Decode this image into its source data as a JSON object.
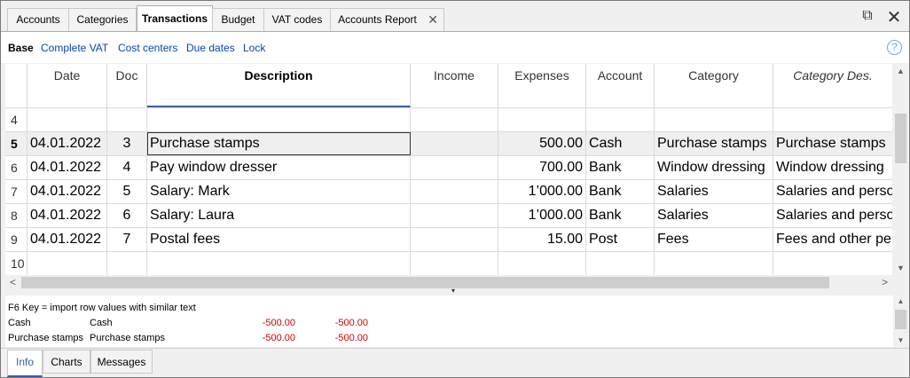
{
  "tabs": [
    {
      "label": "Accounts"
    },
    {
      "label": "Categories"
    },
    {
      "label": "Transactions"
    },
    {
      "label": "Budget"
    },
    {
      "label": "VAT codes"
    },
    {
      "label": "Accounts Report"
    }
  ],
  "active_tab": "Transactions",
  "window_controls": {
    "restore_icon": "restore-icon",
    "close_icon": "close-icon",
    "restore_glyph": "⧉",
    "close_glyph": "✕"
  },
  "views": {
    "items": [
      {
        "label": "Base"
      },
      {
        "label": "Complete VAT"
      },
      {
        "label": "Cost centers"
      },
      {
        "label": "Due dates"
      },
      {
        "label": "Lock"
      }
    ],
    "help_glyph": "?"
  },
  "table": {
    "columns": [
      "Date",
      "Doc",
      "Description",
      "Income",
      "Expenses",
      "Account",
      "Category",
      "Category Des."
    ],
    "rows": [
      {
        "num": "4",
        "date": "",
        "doc": "",
        "description": "",
        "income": "",
        "expenses": "",
        "account": "",
        "category": "",
        "category_desc": ""
      },
      {
        "num": "5",
        "date": "04.01.2022",
        "doc": "3",
        "description": "Purchase stamps",
        "income": "",
        "expenses": "500.00",
        "account": "Cash",
        "category": "Purchase stamps",
        "category_desc": "Purchase stamps"
      },
      {
        "num": "6",
        "date": "04.01.2022",
        "doc": "4",
        "description": "Pay window dresser",
        "income": "",
        "expenses": "700.00",
        "account": "Bank",
        "category": "Window dressing",
        "category_desc": "Window dressing"
      },
      {
        "num": "7",
        "date": "04.01.2022",
        "doc": "5",
        "description": "Salary: Mark",
        "income": "",
        "expenses": "1’000.00",
        "account": "Bank",
        "category": "Salaries",
        "category_desc": "Salaries and perso"
      },
      {
        "num": "8",
        "date": "04.01.2022",
        "doc": "6",
        "description": "Salary: Laura",
        "income": "",
        "expenses": "1’000.00",
        "account": "Bank",
        "category": "Salaries",
        "category_desc": "Salaries and perso"
      },
      {
        "num": "9",
        "date": "04.01.2022",
        "doc": "7",
        "description": "Postal fees",
        "income": "",
        "expenses": "15.00",
        "account": "Post",
        "category": "Fees",
        "category_desc": "Fees and other per"
      },
      {
        "num": "10",
        "date": "",
        "doc": "",
        "description": "",
        "income": "",
        "expenses": "",
        "account": "",
        "category": "",
        "category_desc": ""
      }
    ],
    "selected_row": "5"
  },
  "scroll_glyphs": {
    "up": "▲",
    "down": "▼",
    "left": "<",
    "right": ">",
    "splitter": "▾"
  },
  "info": {
    "hint": "F6 Key = import row values with similar text",
    "lines": [
      {
        "col1": "Cash",
        "col2": "Cash",
        "amount1": "-500.00",
        "amount2": "-500.00"
      },
      {
        "col1": "Purchase stamps",
        "col2": "Purchase stamps",
        "amount1": "-500.00",
        "amount2": "-500.00"
      }
    ]
  },
  "bottom_tabs": [
    {
      "label": "Info"
    },
    {
      "label": "Charts"
    },
    {
      "label": "Messages"
    }
  ],
  "colors": {
    "link": "#0645ad",
    "negative": "#d40000",
    "accent": "#3b5ea8"
  }
}
